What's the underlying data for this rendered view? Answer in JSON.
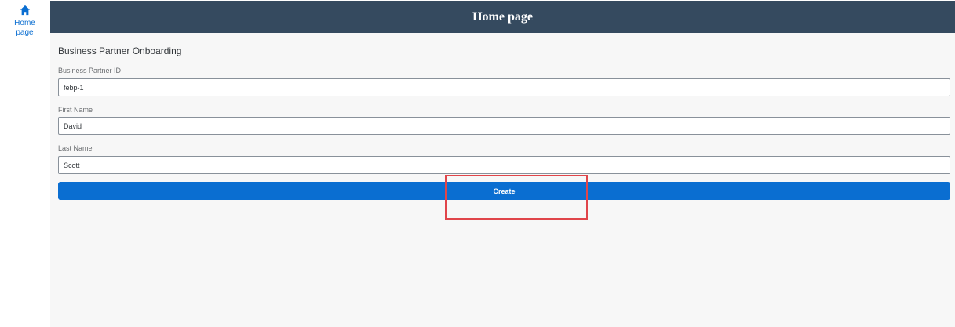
{
  "sidebar": {
    "items": [
      {
        "label": "Home page",
        "icon": "home-icon"
      }
    ]
  },
  "header": {
    "title": "Home page"
  },
  "form": {
    "title": "Business Partner Onboarding",
    "fields": [
      {
        "label": "Business Partner ID",
        "value": "febp-1"
      },
      {
        "label": "First Name",
        "value": "David"
      },
      {
        "label": "Last Name",
        "value": "Scott"
      }
    ],
    "create_label": "Create"
  },
  "colors": {
    "header_bg": "#354a5f",
    "accent": "#0a6ed1",
    "highlight": "#e0454a",
    "content_bg": "#f7f7f7"
  }
}
